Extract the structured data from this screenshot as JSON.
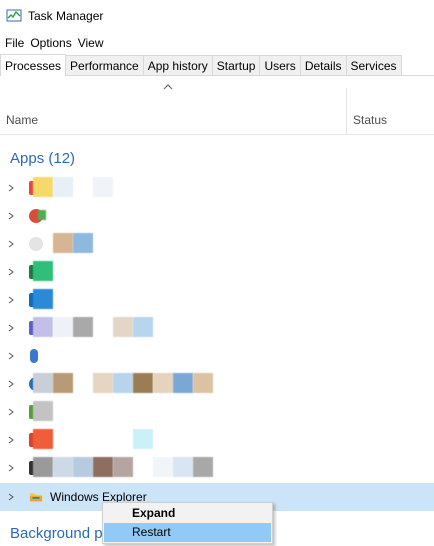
{
  "window": {
    "title": "Task Manager",
    "icon": "task-manager-icon"
  },
  "menu": [
    "File",
    "Options",
    "View"
  ],
  "tabs": [
    {
      "label": "Processes",
      "active": true
    },
    {
      "label": "Performance",
      "active": false
    },
    {
      "label": "App history",
      "active": false
    },
    {
      "label": "Startup",
      "active": false
    },
    {
      "label": "Users",
      "active": false
    },
    {
      "label": "Details",
      "active": false
    },
    {
      "label": "Services",
      "active": false
    }
  ],
  "columns": {
    "name": "Name",
    "status": "Status"
  },
  "groups": {
    "apps": "Apps (12)",
    "background": "Background p"
  },
  "selected_row": {
    "label": "Windows Explorer",
    "icon": "folder-icon"
  },
  "context_menu": {
    "items": [
      "Expand",
      "Restart"
    ]
  },
  "colors": {
    "accent_blue": "#2a6ab8",
    "selection": "#cce4f7",
    "menu_hover": "#91c9f7"
  }
}
